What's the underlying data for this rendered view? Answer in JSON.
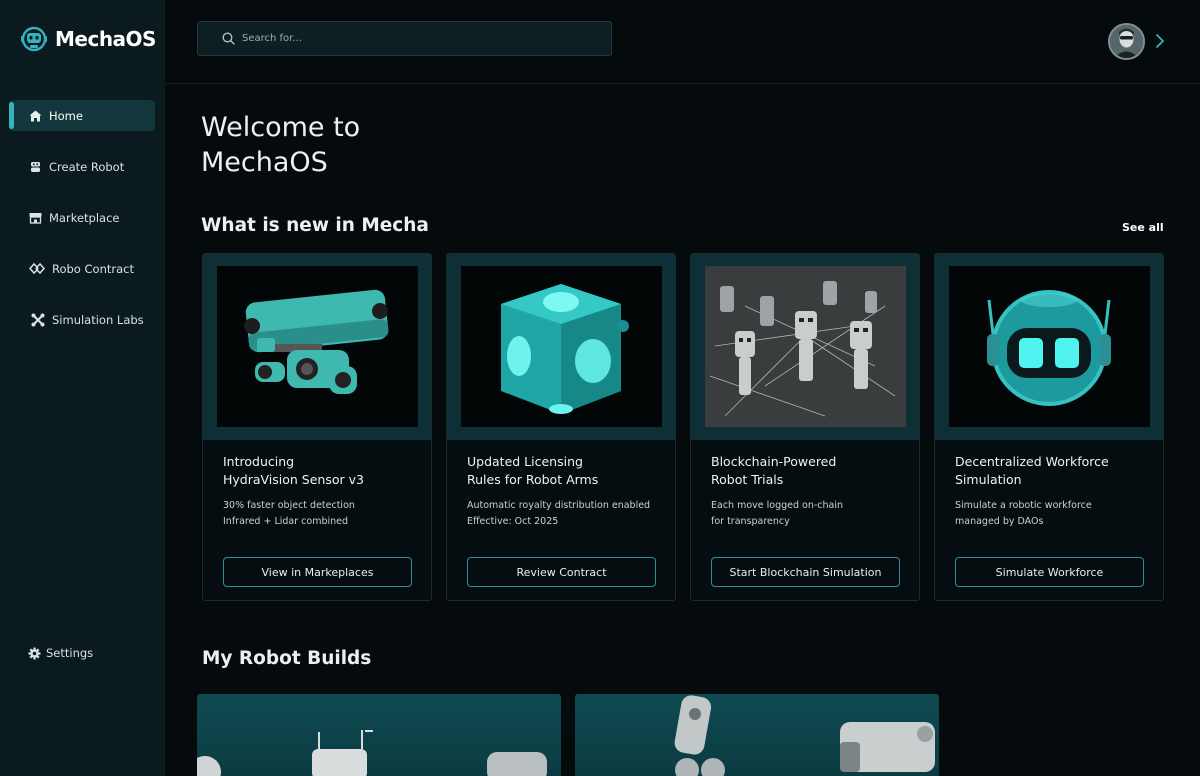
{
  "app": {
    "name": "MechaOS"
  },
  "sidebar": {
    "items": [
      {
        "label": "Home",
        "icon": "home-icon",
        "active": true
      },
      {
        "label": "Create Robot",
        "icon": "robot-icon",
        "active": false
      },
      {
        "label": "Marketplace",
        "icon": "store-icon",
        "active": false
      },
      {
        "label": "Robo Contract",
        "icon": "contract-icon",
        "active": false
      },
      {
        "label": "Simulation Labs",
        "icon": "simulation-icon",
        "active": false
      }
    ],
    "settings_label": "Settings"
  },
  "header": {
    "search_placeholder": "Search for..."
  },
  "main": {
    "welcome_line1": "Welcome to",
    "welcome_line2": "MechaOS",
    "news_title": "What is new in Mecha",
    "see_all": "See all",
    "cards": [
      {
        "title_line1": "Introducing",
        "title_line2": "HydraVision Sensor v3",
        "desc_line1": "30% faster object detection",
        "desc_line2": "Infrared + Lidar combined",
        "button": "View in Markeplaces"
      },
      {
        "title_line1": "Updated Licensing",
        "title_line2": "Rules for Robot Arms",
        "desc_line1": "Automatic royalty distribution enabled",
        "desc_line2": "Effective: Oct 2025",
        "button": "Review Contract"
      },
      {
        "title_line1": "Blockchain-Powered",
        "title_line2": "Robot Trials",
        "desc_line1": "Each move logged on-chain",
        "desc_line2": "for transparency",
        "button": "Start Blockchain Simulation"
      },
      {
        "title_line1": "Decentralized Workforce",
        "title_line2": "Simulation",
        "desc_line1": "Simulate a robotic workforce",
        "desc_line2": "managed by DAOs",
        "button": "Simulate Workforce"
      }
    ],
    "builds_title": "My Robot Builds"
  },
  "colors": {
    "accent": "#34b3bf",
    "sidebar_bg": "#0b1a1e",
    "card_top": "#0e2f35",
    "page_bg": "#050a0c"
  }
}
